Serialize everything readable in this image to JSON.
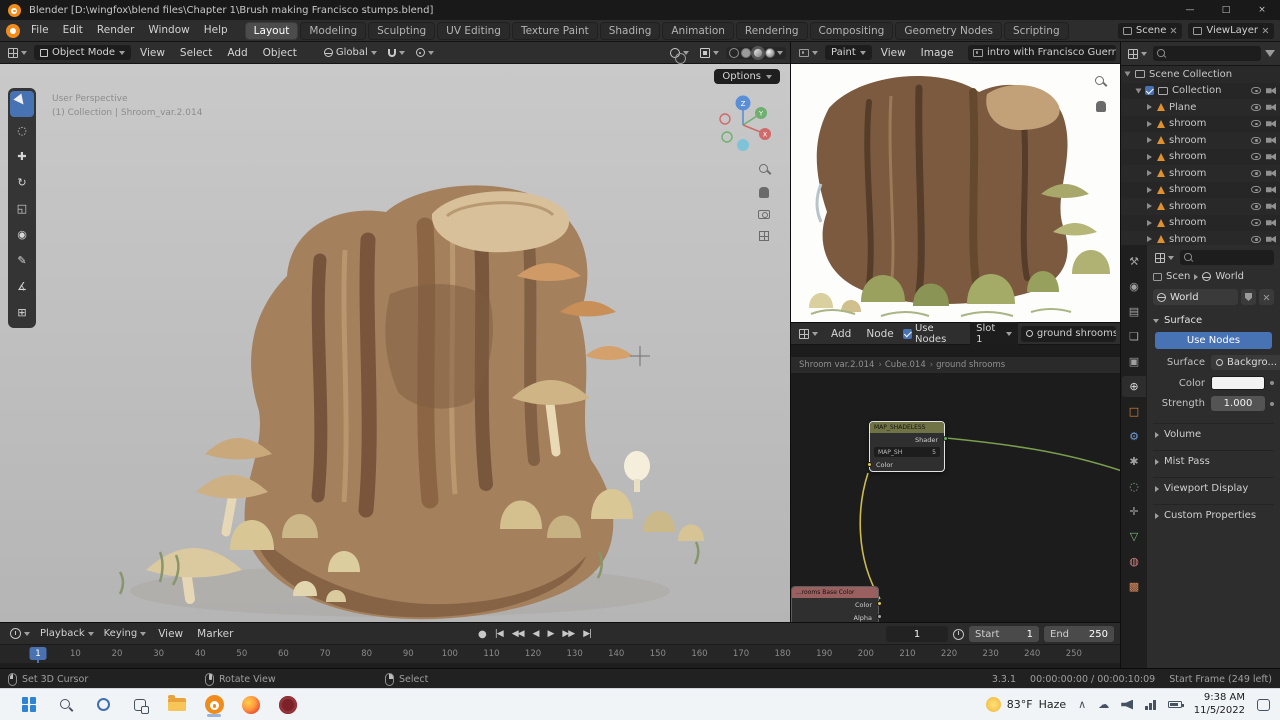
{
  "titlebar": {
    "title": "Blender [D:\\wingfox\\blend files\\Chapter 1\\Brush making  Francisco stumps.blend]",
    "controls": {
      "minimize": "—",
      "maximize": "□",
      "close": "×"
    }
  },
  "topbar": {
    "menus": [
      "File",
      "Edit",
      "Render",
      "Window",
      "Help"
    ],
    "tabs": [
      {
        "label": "Layout",
        "active": true
      },
      {
        "label": "Modeling",
        "active": false
      },
      {
        "label": "Sculpting",
        "active": false
      },
      {
        "label": "UV Editing",
        "active": false
      },
      {
        "label": "Texture Paint",
        "active": false
      },
      {
        "label": "Shading",
        "active": false
      },
      {
        "label": "Animation",
        "active": false
      },
      {
        "label": "Rendering",
        "active": false
      },
      {
        "label": "Compositing",
        "active": false
      },
      {
        "label": "Geometry Nodes",
        "active": false
      },
      {
        "label": "Scripting",
        "active": false
      }
    ],
    "scene": "Scene",
    "view_layer": "ViewLayer"
  },
  "viewport": {
    "mode": "Object Mode",
    "menus": [
      "View",
      "Select",
      "Add",
      "Object"
    ],
    "orientation": "Global",
    "options_label": "Options",
    "overlay_line1": "User Perspective",
    "overlay_line2": "(1) Collection | Shroom_var.2.014",
    "gizmo": {
      "x": "X",
      "y": "Y",
      "z": "Z"
    }
  },
  "icons": {
    "cursor": "◌",
    "move": "✚",
    "rotate": "↻",
    "scale": "◱",
    "transform": "◉",
    "annotate": "✎",
    "measure": "∡",
    "add_cube": "⊞"
  },
  "image_editor": {
    "mode": "Paint",
    "menus": [
      "View",
      "Image"
    ],
    "image_name": "intro with Francisco Guerr"
  },
  "shader_editor": {
    "menus": [
      "Add",
      "Node"
    ],
    "use_nodes": "Use Nodes",
    "slot": "Slot 1",
    "material": "ground shrooms",
    "breadcrumb": [
      "Shroom var.2.014",
      "Cube.014",
      "ground shrooms"
    ],
    "node": {
      "title": "MAP_SHADELESS",
      "output": "Shader",
      "field": "MAP_SH",
      "field_value": "5",
      "input": "Color"
    },
    "corner_node": {
      "title": "...rooms Base Color",
      "outputs": [
        "Color",
        "Alpha"
      ]
    }
  },
  "outliner": {
    "items": [
      {
        "label": "Scene Collection",
        "depth": 0,
        "icon": "collection",
        "checkbox": false,
        "toggles": false
      },
      {
        "label": "Collection",
        "depth": 1,
        "icon": "collection",
        "checkbox": true,
        "toggles": true
      },
      {
        "label": "Plane",
        "depth": 2,
        "icon": "mesh",
        "checkbox": false,
        "toggles": true
      },
      {
        "label": "shroom",
        "depth": 2,
        "icon": "mesh",
        "checkbox": false,
        "toggles": true
      },
      {
        "label": "shroom",
        "depth": 2,
        "icon": "mesh",
        "checkbox": false,
        "toggles": true
      },
      {
        "label": "shroom",
        "depth": 2,
        "icon": "mesh",
        "checkbox": false,
        "toggles": true
      },
      {
        "label": "shroom",
        "depth": 2,
        "icon": "mesh",
        "checkbox": false,
        "toggles": true
      },
      {
        "label": "shroom",
        "depth": 2,
        "icon": "mesh",
        "checkbox": false,
        "toggles": true
      },
      {
        "label": "shroom",
        "depth": 2,
        "icon": "mesh",
        "checkbox": false,
        "toggles": true
      },
      {
        "label": "shroom",
        "depth": 2,
        "icon": "mesh",
        "checkbox": false,
        "toggles": true
      },
      {
        "label": "shroom",
        "depth": 2,
        "icon": "mesh",
        "checkbox": false,
        "toggles": true
      }
    ]
  },
  "properties": {
    "tabs": [
      {
        "name": "tool",
        "glyph": "⚒",
        "color": "#a0a0a0",
        "active": false
      },
      {
        "name": "render",
        "glyph": "◉",
        "color": "#a0a0a0",
        "active": false
      },
      {
        "name": "output",
        "glyph": "▤",
        "color": "#a0a0a0",
        "active": false
      },
      {
        "name": "view-layer",
        "glyph": "❏",
        "color": "#a0a0a0",
        "active": false
      },
      {
        "name": "scene",
        "glyph": "▣",
        "color": "#a0a0a0",
        "active": false
      },
      {
        "name": "world",
        "glyph": "⊕",
        "color": "#dcdcdc",
        "active": true
      },
      {
        "name": "object",
        "glyph": "□",
        "color": "#e0883a",
        "active": false
      },
      {
        "name": "modifiers",
        "glyph": "⚙",
        "color": "#6f9fd8",
        "active": false
      },
      {
        "name": "particles",
        "glyph": "✱",
        "color": "#a0a0a0",
        "active": false
      },
      {
        "name": "physics",
        "glyph": "◌",
        "color": "#86b386",
        "active": false
      },
      {
        "name": "constraints",
        "glyph": "✛",
        "color": "#a0a0a0",
        "active": false
      },
      {
        "name": "object-data",
        "glyph": "▽",
        "color": "#7fbf7f",
        "active": false
      },
      {
        "name": "material",
        "glyph": "◍",
        "color": "#d47f7f",
        "active": false
      },
      {
        "name": "texture",
        "glyph": "▩",
        "color": "#d88a5e",
        "active": false
      }
    ],
    "breadcrumb": {
      "scene": "Scen",
      "world": "World"
    },
    "datablock": "World",
    "surface_section": "Surface",
    "use_nodes": "Use Nodes",
    "rows": {
      "surface_label": "Surface",
      "surface_value": "Backgro...",
      "color_label": "Color",
      "strength_label": "Strength",
      "strength_value": "1.000"
    },
    "collapsed": [
      "Volume",
      "Mist Pass",
      "Viewport Display",
      "Custom Properties"
    ]
  },
  "timeline": {
    "menus": {
      "playback": "Playback",
      "keying": "Keying",
      "view": "View",
      "marker": "Marker"
    },
    "controls": [
      {
        "name": "record",
        "glyph": "●"
      },
      {
        "name": "jump-to-start",
        "glyph": "|◀"
      },
      {
        "name": "previous-keyframe",
        "glyph": "◀◀"
      },
      {
        "name": "play-reverse",
        "glyph": "◀"
      },
      {
        "name": "play",
        "glyph": "▶"
      },
      {
        "name": "next-keyframe",
        "glyph": "▶▶"
      },
      {
        "name": "jump-to-end",
        "glyph": "▶|"
      }
    ],
    "frame": "1",
    "start_label": "Start",
    "start_value": "1",
    "end_label": "End",
    "end_value": "250",
    "ticks": [
      10,
      20,
      30,
      40,
      50,
      60,
      70,
      80,
      90,
      100,
      110,
      120,
      130,
      140,
      150,
      160,
      170,
      180,
      190,
      200,
      210,
      220,
      230,
      240,
      250
    ]
  },
  "statusbar": {
    "hints": [
      {
        "mouse": "left",
        "label": "Set 3D Cursor"
      },
      {
        "mouse": "middle",
        "label": "Rotate View"
      },
      {
        "mouse": "right",
        "label": "Select"
      }
    ],
    "version": "3.3.1",
    "timecode": "00:00:00:00 / 00:00:10:09",
    "note": "Start Frame (249 left)"
  },
  "taskbar": {
    "weather_temp": "83°F",
    "weather_cond": "Haze",
    "time": "9:38 AM",
    "date": "11/5/2022"
  },
  "colors": {
    "accent": "#4772b3",
    "mesh_icon": "#e0902f",
    "blender_orange": "#f08c1c"
  }
}
